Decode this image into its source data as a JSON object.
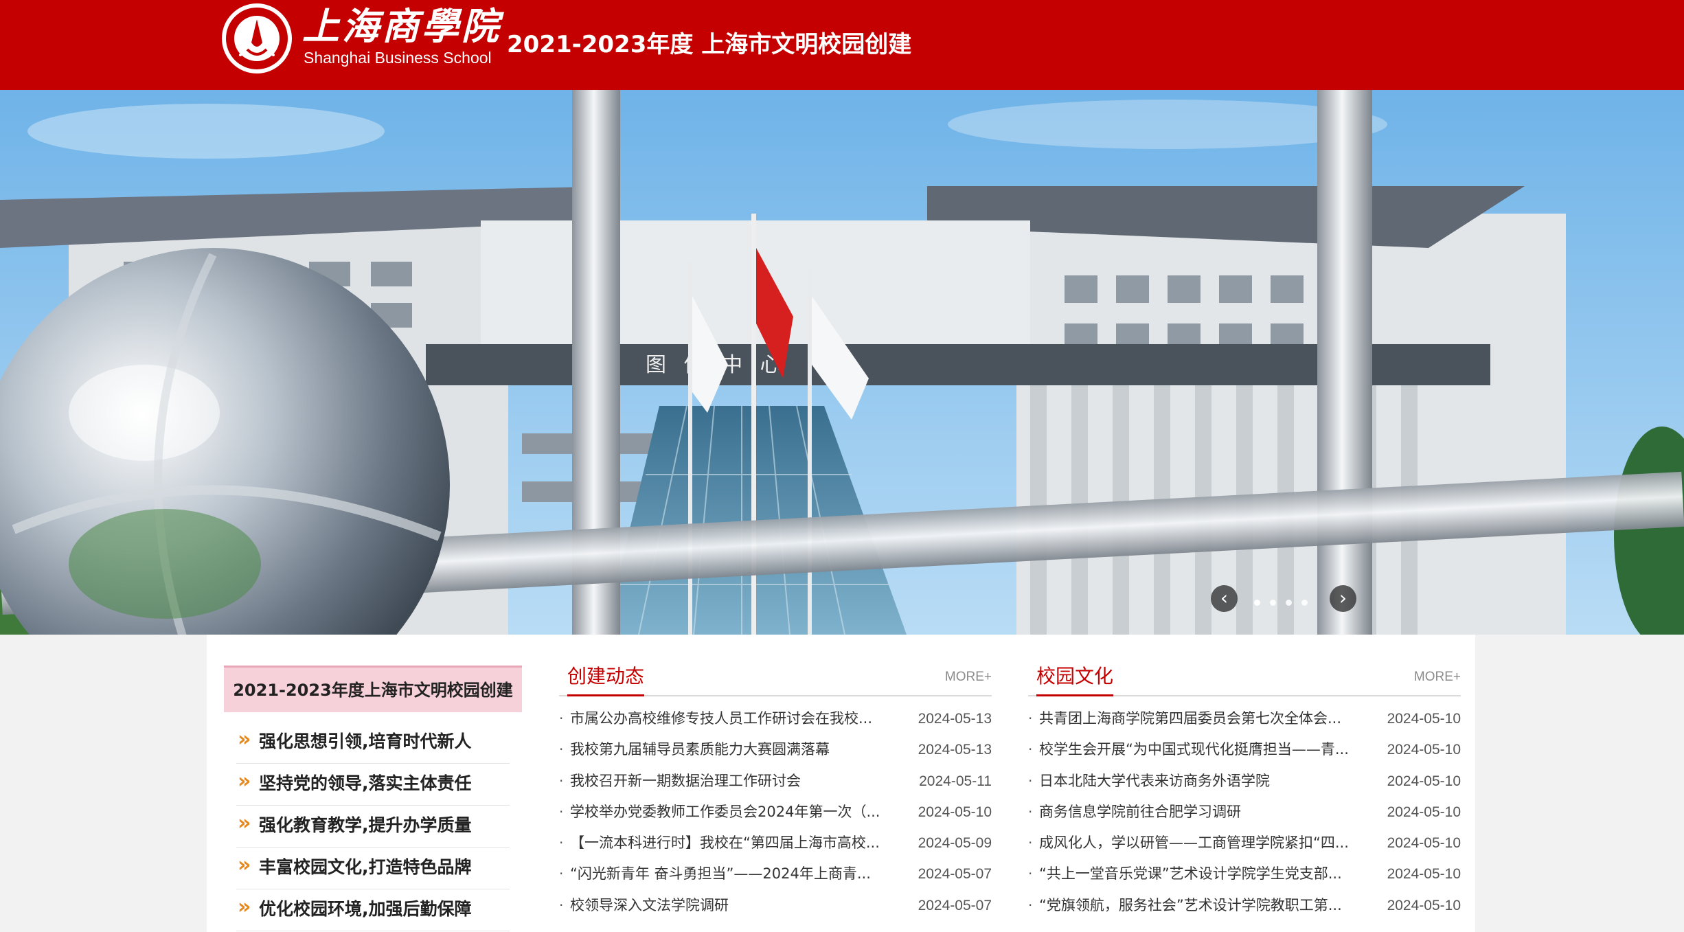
{
  "header": {
    "logo_cn": "上海商學院",
    "logo_en": "Shanghai Business School",
    "site_title": "2021-2023年度 上海市文明校园创建"
  },
  "banner": {
    "building_sign": "图 信 中 心",
    "prev_icon": "chevron-left-icon",
    "next_icon": "chevron-right-icon",
    "prev_glyph": "‹",
    "next_glyph": "›",
    "slide_count": 4,
    "active_slide": 1
  },
  "sidebar": {
    "title": "2021-2023年度上海市文明校园创建",
    "chevron_glyph": "»",
    "items": [
      {
        "label": "强化思想引领,培育时代新人"
      },
      {
        "label": "坚持党的领导,落实主体责任"
      },
      {
        "label": "强化教育教学,提升办学质量"
      },
      {
        "label": "丰富校园文化,打造特色品牌"
      },
      {
        "label": "优化校园环境,加强后勤保障"
      }
    ]
  },
  "columns": [
    {
      "title": "创建动态",
      "more": "MORE+",
      "items": [
        {
          "title": "市属公办高校维修专技人员工作研讨会在我校...",
          "date": "2024-05-13"
        },
        {
          "title": "我校第九届辅导员素质能力大赛圆满落幕",
          "date": "2024-05-13"
        },
        {
          "title": "我校召开新一期数据治理工作研讨会",
          "date": "2024-05-11"
        },
        {
          "title": "学校举办党委教师工作委员会2024年第一次（...",
          "date": "2024-05-10"
        },
        {
          "title": "【一流本科进行时】我校在“第四届上海市高校...",
          "date": "2024-05-09"
        },
        {
          "title": "“闪光新青年 奋斗勇担当”——2024年上商青...",
          "date": "2024-05-07"
        },
        {
          "title": "校领导深入文法学院调研",
          "date": "2024-05-07"
        }
      ]
    },
    {
      "title": "校园文化",
      "more": "MORE+",
      "items": [
        {
          "title": "共青团上海商学院第四届委员会第七次全体会...",
          "date": "2024-05-10"
        },
        {
          "title": "校学生会开展“为中国式现代化挺膺担当——青...",
          "date": "2024-05-10"
        },
        {
          "title": "日本北陆大学代表来访商务外语学院",
          "date": "2024-05-10"
        },
        {
          "title": "商务信息学院前往合肥学习调研",
          "date": "2024-05-10"
        },
        {
          "title": "成风化人，学以研管——工商管理学院紧扣“四...",
          "date": "2024-05-10"
        },
        {
          "title": "“共上一堂音乐党课”艺术设计学院学生党支部...",
          "date": "2024-05-10"
        },
        {
          "title": "“党旗领航，服务社会”艺术设计学院教职工第...",
          "date": "2024-05-10"
        }
      ]
    }
  ],
  "colors": {
    "brand_red": "#c40000",
    "sidebar_title_bg": "#f6d1d9",
    "chevron_orange": "#e5891f"
  }
}
